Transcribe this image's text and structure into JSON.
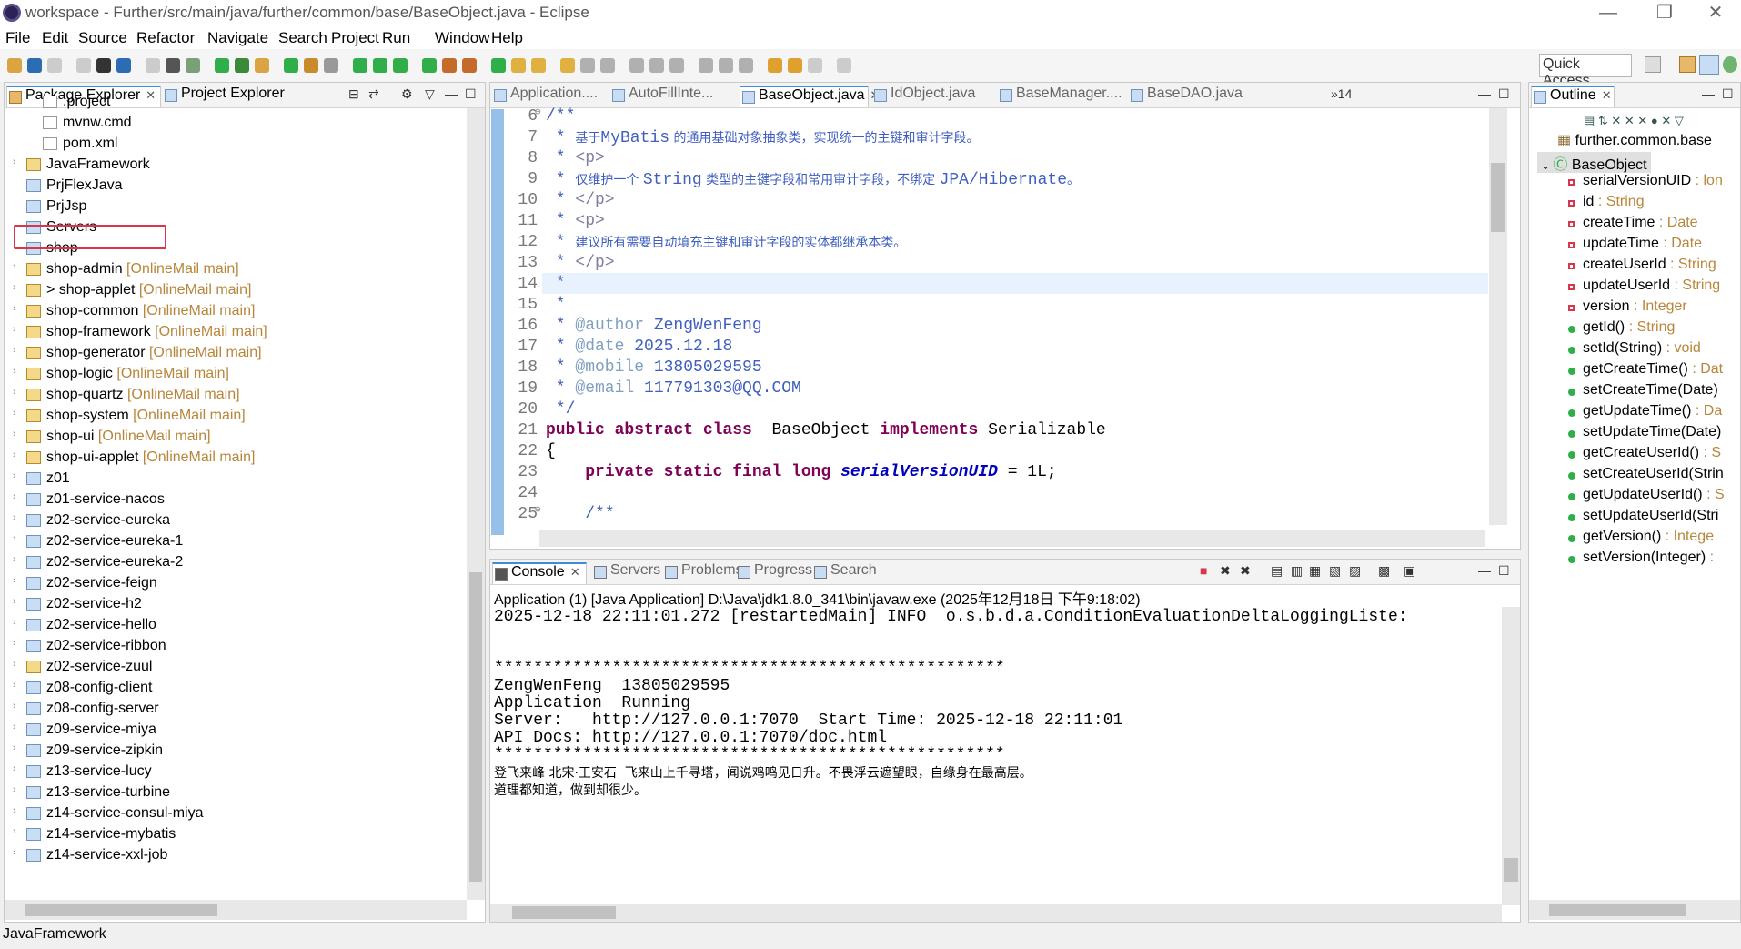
{
  "window": {
    "title": "workspace - Further/src/main/java/further/common/base/BaseObject.java - Eclipse",
    "min": "—",
    "max": "❐",
    "close": "✕"
  },
  "menu": [
    "File",
    "Edit",
    "Source",
    "Refactor",
    "Navigate",
    "Search",
    "Project",
    "Run",
    "Window",
    "Help"
  ],
  "quick_access": "Quick Access",
  "left_pane": {
    "tabs": [
      {
        "label": "Package Explorer",
        "active": true
      },
      {
        "label": "Project Explorer",
        "active": false
      }
    ],
    "tree": [
      {
        "label": ".project",
        "extra": "",
        "icon": "file-icon",
        "arrow": false,
        "indent": 1
      },
      {
        "label": "mvnw.cmd",
        "extra": "",
        "icon": "file-icon",
        "arrow": false,
        "indent": 1
      },
      {
        "label": "pom.xml",
        "extra": "",
        "icon": "file-icon",
        "arrow": false,
        "indent": 1
      },
      {
        "label": "JavaFramework",
        "extra": "",
        "icon": "project-icon",
        "arrow": true,
        "indent": 0
      },
      {
        "label": "PrjFlexJava",
        "extra": "",
        "icon": "folder-icon",
        "arrow": false,
        "indent": 0
      },
      {
        "label": "PrjJsp",
        "extra": "",
        "icon": "folder-icon",
        "arrow": false,
        "indent": 0
      },
      {
        "label": "Servers",
        "extra": "",
        "icon": "folder-icon",
        "arrow": false,
        "indent": 0
      },
      {
        "label": "shop",
        "extra": "",
        "icon": "folder-icon",
        "arrow": false,
        "indent": 0
      },
      {
        "label": "shop-admin",
        "extra": " [OnlineMail main]",
        "icon": "project-icon",
        "arrow": true,
        "indent": 0
      },
      {
        "label": "> shop-applet",
        "extra": " [OnlineMail main]",
        "icon": "project-icon",
        "arrow": true,
        "indent": 0
      },
      {
        "label": "shop-common",
        "extra": " [OnlineMail main]",
        "icon": "project-icon",
        "arrow": true,
        "indent": 0
      },
      {
        "label": "shop-framework",
        "extra": " [OnlineMail main]",
        "icon": "project-icon",
        "arrow": true,
        "indent": 0
      },
      {
        "label": "shop-generator",
        "extra": " [OnlineMail main]",
        "icon": "project-icon",
        "arrow": true,
        "indent": 0
      },
      {
        "label": "shop-logic",
        "extra": " [OnlineMail main]",
        "icon": "project-icon",
        "arrow": true,
        "indent": 0
      },
      {
        "label": "shop-quartz",
        "extra": " [OnlineMail main]",
        "icon": "project-icon",
        "arrow": true,
        "indent": 0
      },
      {
        "label": "shop-system",
        "extra": " [OnlineMail main]",
        "icon": "project-icon",
        "arrow": true,
        "indent": 0
      },
      {
        "label": "shop-ui",
        "extra": " [OnlineMail main]",
        "icon": "project-icon",
        "arrow": true,
        "indent": 0
      },
      {
        "label": "shop-ui-applet",
        "extra": " [OnlineMail main]",
        "icon": "project-icon",
        "arrow": true,
        "indent": 0
      },
      {
        "label": "z01",
        "extra": "",
        "icon": "folder-icon",
        "arrow": true,
        "indent": 0
      },
      {
        "label": "z01-service-nacos",
        "extra": "",
        "icon": "folder-icon",
        "arrow": true,
        "indent": 0
      },
      {
        "label": "z02-service-eureka",
        "extra": "",
        "icon": "folder-icon",
        "arrow": true,
        "indent": 0
      },
      {
        "label": "z02-service-eureka-1",
        "extra": "",
        "icon": "folder-icon",
        "arrow": true,
        "indent": 0
      },
      {
        "label": "z02-service-eureka-2",
        "extra": "",
        "icon": "folder-icon",
        "arrow": true,
        "indent": 0
      },
      {
        "label": "z02-service-feign",
        "extra": "",
        "icon": "folder-icon",
        "arrow": true,
        "indent": 0
      },
      {
        "label": "z02-service-h2",
        "extra": "",
        "icon": "folder-icon",
        "arrow": true,
        "indent": 0
      },
      {
        "label": "z02-service-hello",
        "extra": "",
        "icon": "folder-icon",
        "arrow": true,
        "indent": 0
      },
      {
        "label": "z02-service-ribbon",
        "extra": "",
        "icon": "folder-icon",
        "arrow": true,
        "indent": 0
      },
      {
        "label": "z02-service-zuul",
        "extra": "",
        "icon": "project-icon",
        "arrow": true,
        "indent": 0
      },
      {
        "label": "z08-config-client",
        "extra": "",
        "icon": "folder-icon",
        "arrow": true,
        "indent": 0
      },
      {
        "label": "z08-config-server",
        "extra": "",
        "icon": "folder-icon",
        "arrow": true,
        "indent": 0
      },
      {
        "label": "z09-service-miya",
        "extra": "",
        "icon": "folder-icon",
        "arrow": true,
        "indent": 0
      },
      {
        "label": "z09-service-zipkin",
        "extra": "",
        "icon": "folder-icon",
        "arrow": true,
        "indent": 0
      },
      {
        "label": "z13-service-lucy",
        "extra": "",
        "icon": "folder-icon",
        "arrow": true,
        "indent": 0
      },
      {
        "label": "z13-service-turbine",
        "extra": "",
        "icon": "folder-icon",
        "arrow": true,
        "indent": 0
      },
      {
        "label": "z14-service-consul-miya",
        "extra": "",
        "icon": "folder-icon",
        "arrow": true,
        "indent": 0
      },
      {
        "label": "z14-service-mybatis",
        "extra": "",
        "icon": "folder-icon",
        "arrow": true,
        "indent": 0
      },
      {
        "label": "z14-service-xxl-job",
        "extra": "",
        "icon": "folder-icon",
        "arrow": true,
        "indent": 0
      }
    ]
  },
  "editor": {
    "tabs": [
      {
        "label": "Application....",
        "active": false
      },
      {
        "label": "AutoFillInte...",
        "active": false
      },
      {
        "label": "BaseObject.java",
        "active": true
      },
      {
        "label": "IdObject.java",
        "active": false
      },
      {
        "label": "BaseManager....",
        "active": false
      },
      {
        "label": "BaseDAO.java",
        "active": false
      }
    ],
    "overflow": "»14",
    "lines": [
      {
        "n": "6",
        "fold": "⊖",
        "segs": [
          [
            "c-com",
            "/**"
          ]
        ]
      },
      {
        "n": "7",
        "segs": [
          [
            "c-com",
            " * "
          ],
          [
            "c-com c-cn",
            "基于"
          ],
          [
            "c-com",
            "MyBatis"
          ],
          [
            "c-com c-cn",
            " 的通用基础对象抽象类，实现统一的主键和审计字段。"
          ]
        ]
      },
      {
        "n": "8",
        "segs": [
          [
            "c-com",
            " * "
          ],
          [
            "c-tag",
            "<p>"
          ]
        ]
      },
      {
        "n": "9",
        "segs": [
          [
            "c-com",
            " * "
          ],
          [
            "c-com c-cn",
            "仅维护一个 "
          ],
          [
            "c-com",
            "String"
          ],
          [
            "c-com c-cn",
            " 类型的主键字段和常用审计字段，不绑定 "
          ],
          [
            "c-com",
            "JPA/Hibernate"
          ],
          [
            "c-com c-cn",
            "。"
          ]
        ]
      },
      {
        "n": "10",
        "segs": [
          [
            "c-com",
            " * "
          ],
          [
            "c-tag",
            "</p>"
          ]
        ]
      },
      {
        "n": "11",
        "segs": [
          [
            "c-com",
            " * "
          ],
          [
            "c-tag",
            "<p>"
          ]
        ]
      },
      {
        "n": "12",
        "segs": [
          [
            "c-com",
            " * "
          ],
          [
            "c-com c-cn",
            "建议所有需要自动填充主键和审计字段的实体都继承本类。"
          ]
        ]
      },
      {
        "n": "13",
        "segs": [
          [
            "c-com",
            " * "
          ],
          [
            "c-tag",
            "</p>"
          ]
        ]
      },
      {
        "n": "14",
        "segs": [
          [
            "c-com",
            " *"
          ]
        ]
      },
      {
        "n": "15",
        "segs": [
          [
            "c-com",
            " *"
          ]
        ]
      },
      {
        "n": "16",
        "segs": [
          [
            "c-com",
            " * "
          ],
          [
            "c-anno",
            "@author"
          ],
          [
            "c-com",
            " ZengWenFeng"
          ]
        ]
      },
      {
        "n": "17",
        "segs": [
          [
            "c-com",
            " * "
          ],
          [
            "c-anno",
            "@date"
          ],
          [
            "c-com",
            " 2025.12.18"
          ]
        ]
      },
      {
        "n": "18",
        "segs": [
          [
            "c-com",
            " * "
          ],
          [
            "c-anno",
            "@mobile"
          ],
          [
            "c-com",
            " 13805029595"
          ]
        ]
      },
      {
        "n": "19",
        "segs": [
          [
            "c-com",
            " * "
          ],
          [
            "c-anno",
            "@email"
          ],
          [
            "c-com",
            " 117791303@QQ.COM"
          ]
        ]
      },
      {
        "n": "20",
        "segs": [
          [
            "c-com",
            " */"
          ]
        ]
      },
      {
        "n": "21",
        "segs": [
          [
            "c-kw",
            "public abstract class"
          ],
          [
            "",
            "  BaseObject "
          ],
          [
            "c-kw",
            "implements"
          ],
          [
            "",
            " Serializable"
          ]
        ]
      },
      {
        "n": "22",
        "segs": [
          [
            "",
            "{"
          ]
        ]
      },
      {
        "n": "23",
        "segs": [
          [
            "",
            "    "
          ],
          [
            "c-kw",
            "private static final long"
          ],
          [
            "",
            " "
          ],
          [
            "c-fld",
            "serialVersionUID"
          ],
          [
            "",
            " = 1L;"
          ]
        ]
      },
      {
        "n": "24",
        "segs": [
          [
            "",
            ""
          ]
        ]
      },
      {
        "n": "25",
        "fold": "⊖",
        "segs": [
          [
            "",
            "    "
          ],
          [
            "c-com",
            "/**"
          ]
        ]
      }
    ]
  },
  "console": {
    "tabs": [
      {
        "label": "Console",
        "active": true
      },
      {
        "label": "Servers",
        "active": false
      },
      {
        "label": "Problems",
        "active": false
      },
      {
        "label": "Progress",
        "active": false
      },
      {
        "label": "Search",
        "active": false
      }
    ],
    "header": "Application (1) [Java Application] D:\\Java\\jdk1.8.0_341\\bin\\javaw.exe (2025年12月18日 下午9:18:02)",
    "lines": [
      {
        "t": "2025-12-18 22:11:01.272 [restartedMain] INFO  o.s.b.d.a.ConditionEvaluationDeltaLoggingListe:",
        "cn": false
      },
      {
        "t": "",
        "cn": false
      },
      {
        "t": "",
        "cn": false
      },
      {
        "t": "****************************************************",
        "cn": false
      },
      {
        "t": "ZengWenFeng  13805029595",
        "cn": false
      },
      {
        "t": "Application  Running",
        "cn": false
      },
      {
        "t": "Server:   http://127.0.0.1:7070  Start Time: 2025-12-18 22:11:01",
        "cn": false
      },
      {
        "t": "API Docs: http://127.0.0.1:7070/doc.html",
        "cn": false
      },
      {
        "t": "****************************************************",
        "cn": false
      },
      {
        "t": "登飞来峰 北宋·王安石  飞来山上千寻塔，闻说鸡鸣见日升。不畏浮云遮望眼，自缘身在最高层。",
        "cn": true
      },
      {
        "t": "道理都知道，做到却很少。",
        "cn": true
      }
    ]
  },
  "outline": {
    "tab": "Outline",
    "package": "further.common.base",
    "class": "BaseObject",
    "items": [
      {
        "name": "serialVersionUID",
        "type": " : lon",
        "kind": "final-field"
      },
      {
        "name": "id",
        "type": " : String",
        "kind": "field"
      },
      {
        "name": "createTime",
        "type": " : Date",
        "kind": "field"
      },
      {
        "name": "updateTime",
        "type": " : Date",
        "kind": "field"
      },
      {
        "name": "createUserId",
        "type": " : String",
        "kind": "field"
      },
      {
        "name": "updateUserId",
        "type": " : String",
        "kind": "field"
      },
      {
        "name": "version",
        "type": " : Integer",
        "kind": "field"
      },
      {
        "name": "getId()",
        "type": " : String",
        "kind": "method"
      },
      {
        "name": "setId(String)",
        "type": " : void",
        "kind": "method"
      },
      {
        "name": "getCreateTime()",
        "type": " : Dat",
        "kind": "method"
      },
      {
        "name": "setCreateTime(Date)",
        "type": "",
        "kind": "method"
      },
      {
        "name": "getUpdateTime()",
        "type": " : Da",
        "kind": "method"
      },
      {
        "name": "setUpdateTime(Date)",
        "type": "",
        "kind": "method"
      },
      {
        "name": "getCreateUserId()",
        "type": " : S",
        "kind": "method"
      },
      {
        "name": "setCreateUserId(Strin",
        "type": "",
        "kind": "method"
      },
      {
        "name": "getUpdateUserId()",
        "type": " : S",
        "kind": "method"
      },
      {
        "name": "setUpdateUserId(Stri",
        "type": "",
        "kind": "method"
      },
      {
        "name": "getVersion()",
        "type": " : Intege",
        "kind": "method"
      },
      {
        "name": "setVersion(Integer)",
        "type": " : ",
        "kind": "method"
      }
    ]
  },
  "status": "JavaFramework",
  "colors": {
    "accent": "#3f8dd6",
    "highlight": "#d9364b",
    "private_field": "#d9364b",
    "public_method": "#2fae4a"
  }
}
